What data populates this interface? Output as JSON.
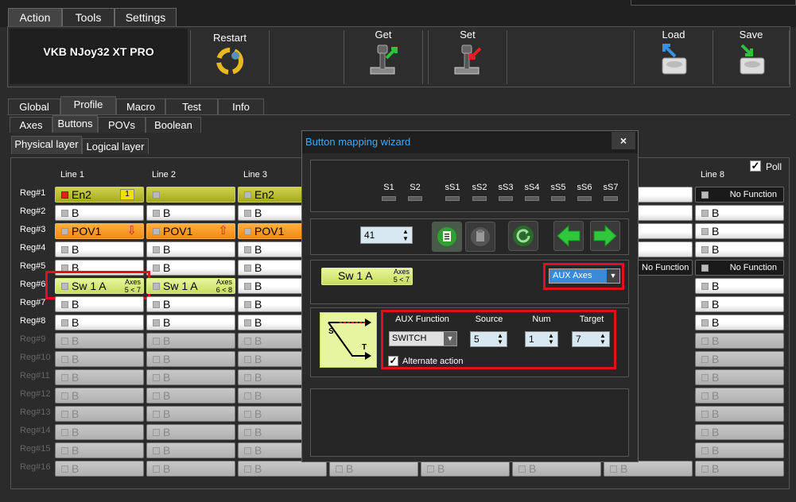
{
  "menu_tabs": [
    "Action",
    "Tools",
    "Settings"
  ],
  "device_name": "VKB NJoy32 XT PRO",
  "toolbar": {
    "restart": "Restart",
    "get": "Get",
    "set": "Set",
    "load": "Load",
    "save": "Save"
  },
  "main_tabs": [
    "Global",
    "Profile",
    "Macro",
    "Test",
    "Info"
  ],
  "sub_tabs": [
    "Axes",
    "Buttons",
    "POVs",
    "Boolean"
  ],
  "layer_tabs": [
    "Physical layer",
    "Logical layer"
  ],
  "line_headers": [
    "Line 1",
    "Line 2",
    "Line 3",
    "Line 8"
  ],
  "poll_label": "Poll",
  "reg_labels": [
    "Reg#1",
    "Reg#2",
    "Reg#3",
    "Reg#4",
    "Reg#5",
    "Reg#6",
    "Reg#7",
    "Reg#8",
    "Reg#9",
    "Reg#10",
    "Reg#11",
    "Reg#12",
    "Reg#13",
    "Reg#14",
    "Reg#15",
    "Reg#16"
  ],
  "cells": {
    "r1c1": "En2",
    "r1c1_badge": "1",
    "r1c3": "En2",
    "r3c1": "POV1",
    "r3c2": "POV1",
    "r3c3": "POV1",
    "b": "B",
    "r6c1": "Sw 1 A",
    "r6c1_axes": "Axes",
    "r6c1_range": "5 < 7",
    "r6c2": "Sw 1 A",
    "r6c2_axes": "Axes",
    "r6c2_range": "6 < 8",
    "no_function": "No Function"
  },
  "dialog": {
    "title": "Button mapping wizard",
    "close": "×",
    "shift_labels": [
      "S1",
      "S2",
      "sS1",
      "sS2",
      "sS3",
      "sS4",
      "sS5",
      "sS6",
      "sS7"
    ],
    "button_number": "41",
    "preview_label": "Sw 1 A",
    "preview_axes": "Axes",
    "preview_range": "5 < 7",
    "type_select": "AUX Axes",
    "aux_function_label": "AUX Function",
    "aux_function_value": "SWITCH",
    "source_label": "Source",
    "source_value": "5",
    "num_label": "Num",
    "num_value": "1",
    "target_label": "Target",
    "target_value": "7",
    "alternate_label": "Alternate action",
    "graphic_s": "S",
    "graphic_t": "T"
  }
}
